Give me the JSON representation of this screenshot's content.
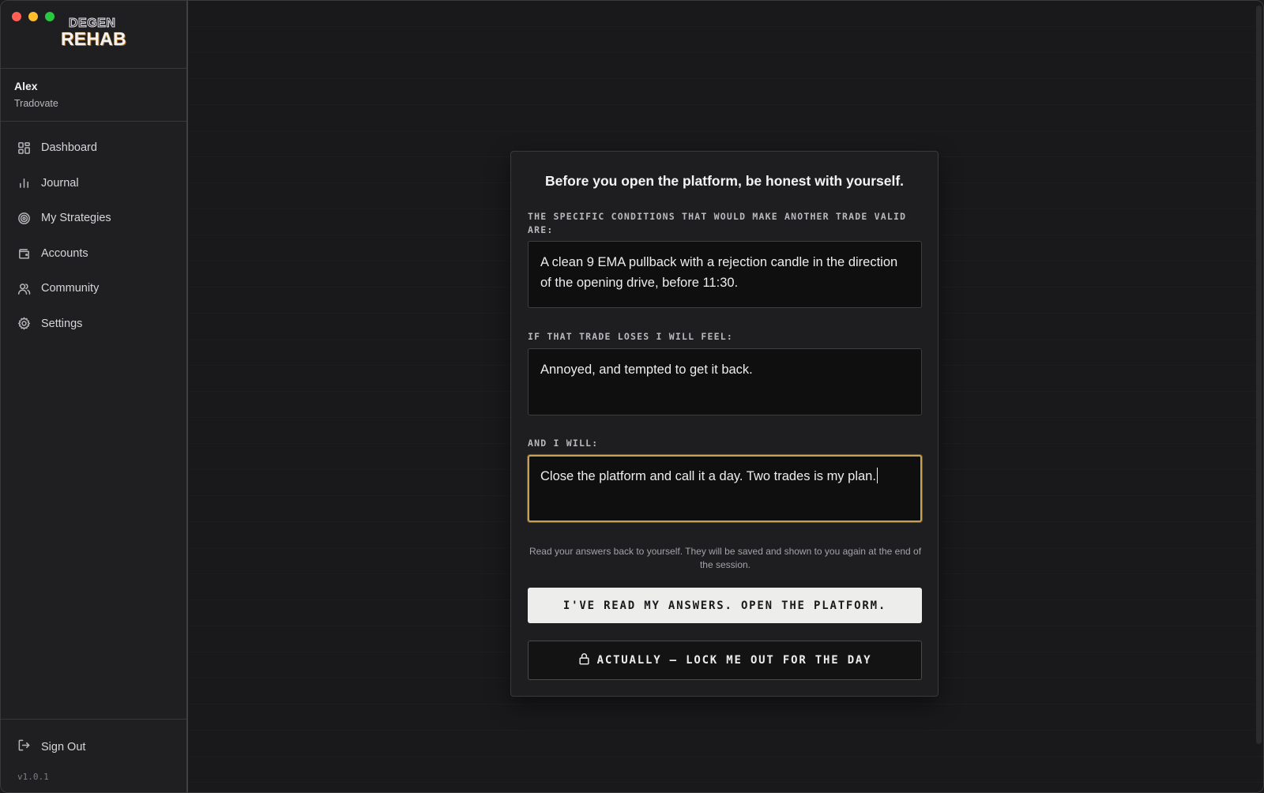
{
  "window": {
    "controls": [
      "close",
      "minimize",
      "zoom"
    ]
  },
  "logo": {
    "line1": "DEGEN",
    "line2": "REHAB"
  },
  "user": {
    "name": "Alex",
    "broker": "Tradovate"
  },
  "sidebar": {
    "items": [
      {
        "label": "Dashboard",
        "icon": "dashboard-icon"
      },
      {
        "label": "Journal",
        "icon": "bar-chart-icon"
      },
      {
        "label": "My Strategies",
        "icon": "target-icon"
      },
      {
        "label": "Accounts",
        "icon": "wallet-icon"
      },
      {
        "label": "Community",
        "icon": "users-icon"
      },
      {
        "label": "Settings",
        "icon": "gear-icon"
      }
    ],
    "signout_label": "Sign Out",
    "version": "v1.0.1"
  },
  "dialog": {
    "title": "Before you open the platform, be honest with yourself.",
    "questions": [
      {
        "label": "THE SPECIFIC CONDITIONS THAT WOULD MAKE ANOTHER TRADE VALID ARE:",
        "answer": "A clean 9 EMA pullback with a rejection candle in the direction of the opening drive, before 11:30."
      },
      {
        "label": "IF THAT TRADE LOSES I WILL FEEL:",
        "answer": "Annoyed, and tempted to get it back."
      },
      {
        "label": "AND I WILL:",
        "answer": "Close the platform and call it a day. Two trades is my plan."
      }
    ],
    "note": "Read your answers back to yourself. They will be saved and shown to you again at the end of the session.",
    "primary_button": "I'VE READ MY ANSWERS. OPEN THE PLATFORM.",
    "secondary_button": "ACTUALLY — LOCK ME OUT FOR THE DAY"
  },
  "colors": {
    "focus_border": "#c7a252",
    "sidebar_bg": "#1f1f21",
    "main_bg": "#19191b"
  }
}
